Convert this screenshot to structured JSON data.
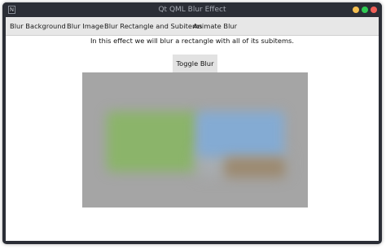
{
  "window": {
    "title": "Qt QML Blur Effect",
    "app_icon": "qt-app-icon",
    "app_icon_glyph": "N",
    "controls": [
      "minimize-icon",
      "maximize-icon",
      "close-icon"
    ]
  },
  "tabs": [
    {
      "label": "Blur Background"
    },
    {
      "label": "Blur Image"
    },
    {
      "label": "Blur Rectangle and Subitems"
    },
    {
      "label": "Animate Blur"
    }
  ],
  "content": {
    "description": "In this effect we will blur a rectangle with all of its subitems.",
    "toggle_label": "Toggle Blur"
  },
  "colors": {
    "titlebar": "#2b2e36",
    "minimize": "#f4bf4f",
    "maximize": "#2fcb53",
    "close": "#f25f57",
    "blur_background": "#a5a5a5",
    "blur_green": "#8bb46a",
    "blur_blue": "#84abd3",
    "blur_brown": "#9c8a71"
  }
}
